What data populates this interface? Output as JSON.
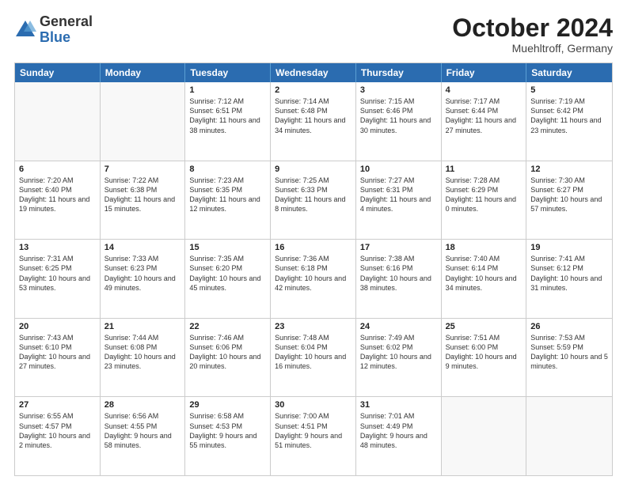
{
  "logo": {
    "general": "General",
    "blue": "Blue"
  },
  "title": "October 2024",
  "location": "Muehltroff, Germany",
  "days_of_week": [
    "Sunday",
    "Monday",
    "Tuesday",
    "Wednesday",
    "Thursday",
    "Friday",
    "Saturday"
  ],
  "rows": [
    [
      {
        "day": "",
        "text": ""
      },
      {
        "day": "",
        "text": ""
      },
      {
        "day": "1",
        "text": "Sunrise: 7:12 AM\nSunset: 6:51 PM\nDaylight: 11 hours and 38 minutes."
      },
      {
        "day": "2",
        "text": "Sunrise: 7:14 AM\nSunset: 6:48 PM\nDaylight: 11 hours and 34 minutes."
      },
      {
        "day": "3",
        "text": "Sunrise: 7:15 AM\nSunset: 6:46 PM\nDaylight: 11 hours and 30 minutes."
      },
      {
        "day": "4",
        "text": "Sunrise: 7:17 AM\nSunset: 6:44 PM\nDaylight: 11 hours and 27 minutes."
      },
      {
        "day": "5",
        "text": "Sunrise: 7:19 AM\nSunset: 6:42 PM\nDaylight: 11 hours and 23 minutes."
      }
    ],
    [
      {
        "day": "6",
        "text": "Sunrise: 7:20 AM\nSunset: 6:40 PM\nDaylight: 11 hours and 19 minutes."
      },
      {
        "day": "7",
        "text": "Sunrise: 7:22 AM\nSunset: 6:38 PM\nDaylight: 11 hours and 15 minutes."
      },
      {
        "day": "8",
        "text": "Sunrise: 7:23 AM\nSunset: 6:35 PM\nDaylight: 11 hours and 12 minutes."
      },
      {
        "day": "9",
        "text": "Sunrise: 7:25 AM\nSunset: 6:33 PM\nDaylight: 11 hours and 8 minutes."
      },
      {
        "day": "10",
        "text": "Sunrise: 7:27 AM\nSunset: 6:31 PM\nDaylight: 11 hours and 4 minutes."
      },
      {
        "day": "11",
        "text": "Sunrise: 7:28 AM\nSunset: 6:29 PM\nDaylight: 11 hours and 0 minutes."
      },
      {
        "day": "12",
        "text": "Sunrise: 7:30 AM\nSunset: 6:27 PM\nDaylight: 10 hours and 57 minutes."
      }
    ],
    [
      {
        "day": "13",
        "text": "Sunrise: 7:31 AM\nSunset: 6:25 PM\nDaylight: 10 hours and 53 minutes."
      },
      {
        "day": "14",
        "text": "Sunrise: 7:33 AM\nSunset: 6:23 PM\nDaylight: 10 hours and 49 minutes."
      },
      {
        "day": "15",
        "text": "Sunrise: 7:35 AM\nSunset: 6:20 PM\nDaylight: 10 hours and 45 minutes."
      },
      {
        "day": "16",
        "text": "Sunrise: 7:36 AM\nSunset: 6:18 PM\nDaylight: 10 hours and 42 minutes."
      },
      {
        "day": "17",
        "text": "Sunrise: 7:38 AM\nSunset: 6:16 PM\nDaylight: 10 hours and 38 minutes."
      },
      {
        "day": "18",
        "text": "Sunrise: 7:40 AM\nSunset: 6:14 PM\nDaylight: 10 hours and 34 minutes."
      },
      {
        "day": "19",
        "text": "Sunrise: 7:41 AM\nSunset: 6:12 PM\nDaylight: 10 hours and 31 minutes."
      }
    ],
    [
      {
        "day": "20",
        "text": "Sunrise: 7:43 AM\nSunset: 6:10 PM\nDaylight: 10 hours and 27 minutes."
      },
      {
        "day": "21",
        "text": "Sunrise: 7:44 AM\nSunset: 6:08 PM\nDaylight: 10 hours and 23 minutes."
      },
      {
        "day": "22",
        "text": "Sunrise: 7:46 AM\nSunset: 6:06 PM\nDaylight: 10 hours and 20 minutes."
      },
      {
        "day": "23",
        "text": "Sunrise: 7:48 AM\nSunset: 6:04 PM\nDaylight: 10 hours and 16 minutes."
      },
      {
        "day": "24",
        "text": "Sunrise: 7:49 AM\nSunset: 6:02 PM\nDaylight: 10 hours and 12 minutes."
      },
      {
        "day": "25",
        "text": "Sunrise: 7:51 AM\nSunset: 6:00 PM\nDaylight: 10 hours and 9 minutes."
      },
      {
        "day": "26",
        "text": "Sunrise: 7:53 AM\nSunset: 5:59 PM\nDaylight: 10 hours and 5 minutes."
      }
    ],
    [
      {
        "day": "27",
        "text": "Sunrise: 6:55 AM\nSunset: 4:57 PM\nDaylight: 10 hours and 2 minutes."
      },
      {
        "day": "28",
        "text": "Sunrise: 6:56 AM\nSunset: 4:55 PM\nDaylight: 9 hours and 58 minutes."
      },
      {
        "day": "29",
        "text": "Sunrise: 6:58 AM\nSunset: 4:53 PM\nDaylight: 9 hours and 55 minutes."
      },
      {
        "day": "30",
        "text": "Sunrise: 7:00 AM\nSunset: 4:51 PM\nDaylight: 9 hours and 51 minutes."
      },
      {
        "day": "31",
        "text": "Sunrise: 7:01 AM\nSunset: 4:49 PM\nDaylight: 9 hours and 48 minutes."
      },
      {
        "day": "",
        "text": ""
      },
      {
        "day": "",
        "text": ""
      }
    ]
  ]
}
